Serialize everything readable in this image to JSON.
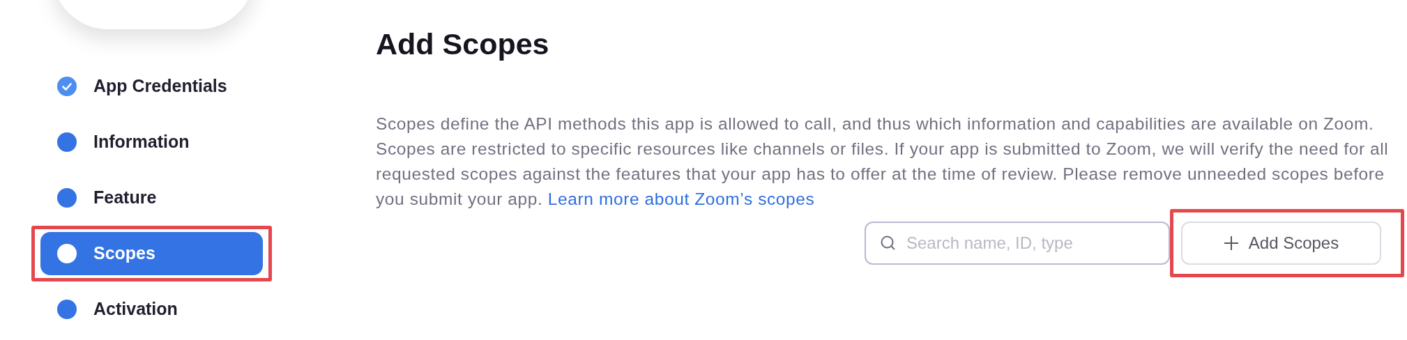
{
  "steps": [
    {
      "label": "App Credentials",
      "done": true,
      "selected": false,
      "annotated": false
    },
    {
      "label": "Information",
      "done": false,
      "selected": false,
      "annotated": false
    },
    {
      "label": "Feature",
      "done": false,
      "selected": false,
      "annotated": false
    },
    {
      "label": "Scopes",
      "done": false,
      "selected": true,
      "annotated": true
    },
    {
      "label": "Activation",
      "done": false,
      "selected": false,
      "annotated": false
    }
  ],
  "heading": "Add Scopes",
  "description": "Scopes define the API methods this app is allowed to call, and thus which information and capabilities are available on Zoom. Scopes are restricted to specific resources like channels or files. If your app is submitted to Zoom, we will verify the need for all requested scopes against the features that your app has to offer at the time of review. Please remove unneeded scopes before you submit your app.",
  "learn_more_link": "Learn more about Zoom’s scopes",
  "search": {
    "placeholder": "Search name, ID, type"
  },
  "add_button": {
    "label": "Add Scopes",
    "annotated": true
  }
}
